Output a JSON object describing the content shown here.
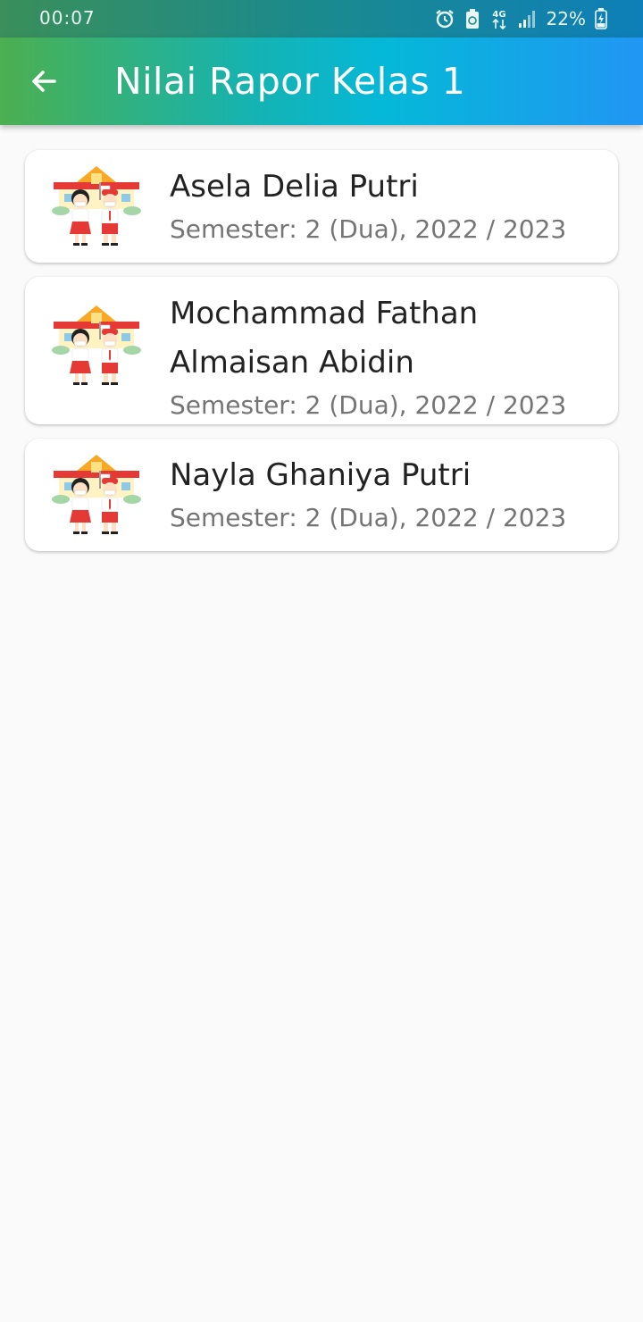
{
  "status_bar": {
    "time": "00:07",
    "battery": "22%",
    "network": "4G",
    "icons": [
      "alarm-icon",
      "battery-saver-icon",
      "network-4g-icon",
      "signal-icon",
      "battery-charging-icon"
    ]
  },
  "app_bar": {
    "title": "Nilai Rapor Kelas 1",
    "back_icon": "arrow-left-icon",
    "colors": {
      "start": "#4caf50",
      "mid": "#05b8d8",
      "end": "#2196f3"
    }
  },
  "students": [
    {
      "name": "Asela Delia Putri",
      "semester": "Semester: 2 (Dua),  2022 / 2023",
      "icon": "school-kids-icon"
    },
    {
      "name": "Mochammad Fathan Almaisan Abidin",
      "semester": "Semester: 2 (Dua),  2022 / 2023",
      "icon": "school-kids-icon"
    },
    {
      "name": "Nayla Ghaniya Putri",
      "semester": "Semester: 2 (Dua),  2022 / 2023",
      "icon": "school-kids-icon"
    }
  ]
}
